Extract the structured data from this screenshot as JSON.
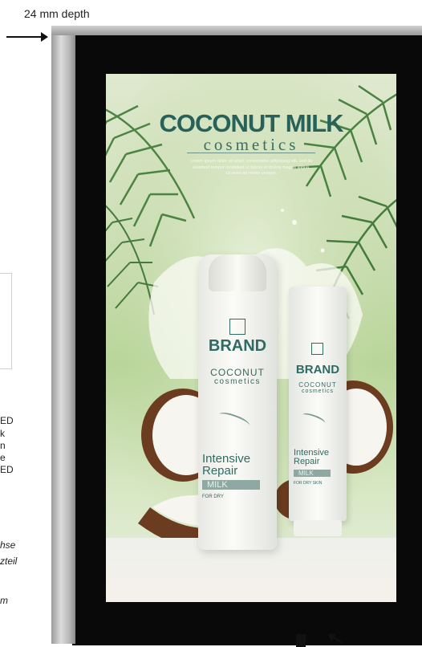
{
  "dimension": {
    "depth_label": "24 mm depth"
  },
  "side_fragments": [
    "ED",
    "k",
    "n",
    "e",
    "ED",
    "hse",
    "zteil",
    "m"
  ],
  "poster": {
    "title": "COCONUT MILK",
    "subtitle": "cosmetics",
    "body": "Lorem ipsum dolor sit amet, consectetur adipiscing elit, sed do eiusmod tempor incididunt ut labore et dolore magna aliqua. Ut enim ad minim veniam."
  },
  "bottle": {
    "brand": "BRAND",
    "line1": "COCONUT",
    "line2": "cosmetics",
    "product1": "Intensive",
    "product2": "Repair",
    "variant": "MILK",
    "note": "FOR DRY"
  },
  "tube": {
    "brand": "BRAND",
    "line1": "COCONUT",
    "line2": "cosmetics",
    "product1": "Intensive",
    "product2": "Repair",
    "variant": "MILK",
    "note": "FOR DRY SKIN"
  },
  "colors": {
    "frame_black": "#090909",
    "frame_aluminium": "#c8c8c8",
    "brand_teal": "#2f6b62",
    "poster_green": "#c6dcab"
  },
  "icons": [
    "arrow-right-icon",
    "arrow-left-icon",
    "arrow-bottom-icon",
    "brand-logo-icon"
  ]
}
